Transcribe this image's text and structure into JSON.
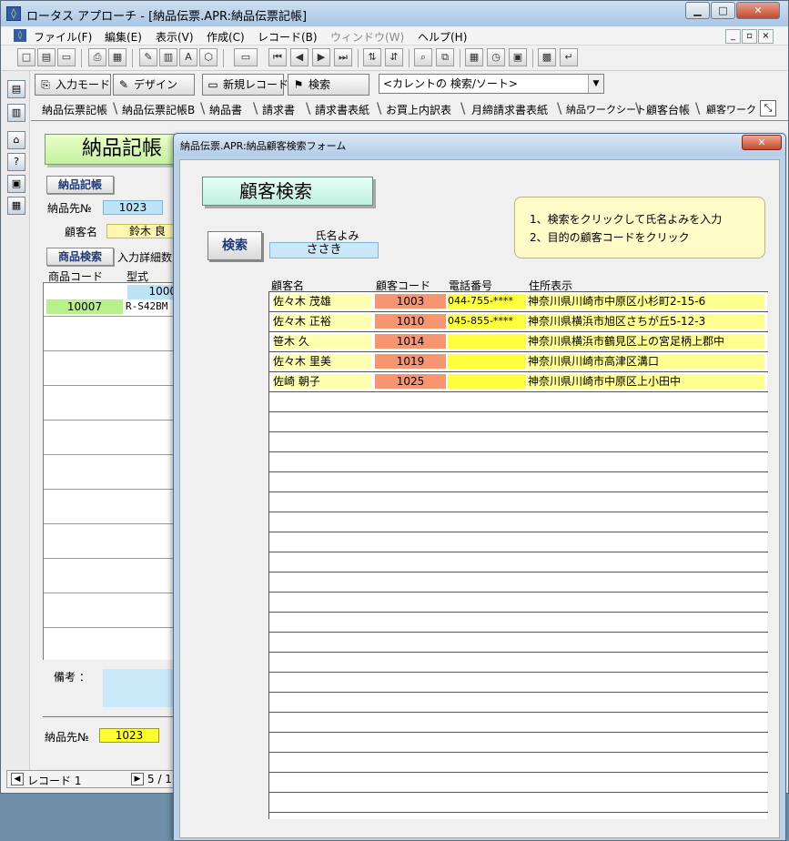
{
  "main_window": {
    "title": "ロータス アプローチ - [納品伝票.APR:納品伝票記帳]",
    "title_icon": "lotus-approach-icon",
    "controls": {
      "minimize": "▁",
      "maximize": "□",
      "close": "✕"
    }
  },
  "menu": {
    "items": [
      "ファイル(F)",
      "編集(E)",
      "表示(V)",
      "作成(C)",
      "レコード(B)",
      "ウィンドウ(W)",
      "ヘルプ(H)"
    ],
    "mdi_controls": [
      "_",
      "▫",
      "×"
    ]
  },
  "toolbar": {
    "icons": [
      "new-file-icon",
      "open-icon",
      "open-folder-icon",
      "print-icon",
      "print-preview-icon",
      "edit-icon",
      "ruler-icon",
      "text-icon",
      "draw-icon",
      "field-icon",
      "first-record-icon",
      "prev-record-icon",
      "next-record-icon",
      "last-record-icon",
      "sort-asc-icon",
      "sort-desc-icon",
      "find-icon",
      "find-all-icon",
      "calendar-icon",
      "timer-icon",
      "clipboard-icon",
      "grid-icon",
      "enter-icon"
    ]
  },
  "left_rail": {
    "icons": [
      "form-icon",
      "report-icon",
      "home-icon",
      "help-icon",
      "server-icon",
      "database-icon"
    ]
  },
  "modebar": {
    "input_mode": "入力モード",
    "design": "デザイン",
    "new_record": "新規レコード",
    "search": "検索",
    "current_search": "<カレントの 検索/ソート>"
  },
  "tabs": [
    "納品伝票記帳",
    "納品伝票記帳B",
    "納品書",
    "請求書",
    "請求書表紙",
    "お買上内訳表",
    "月締請求書表紙",
    "納品ワークシート",
    "顧客台帳",
    "顧客ワークシ"
  ],
  "main_form": {
    "title": "納品記帳",
    "section_delivery": "納品記帳",
    "delivery_no_label": "納品先№",
    "delivery_no_value": "1023",
    "customer_label": "顧客名",
    "customer_value": "鈴木 良",
    "product_search_button": "商品検索",
    "detail_label": "入力詳細数",
    "col_product_code": "商品コード",
    "col_model": "型式",
    "product_rows": [
      {
        "code": "",
        "model": "1000"
      },
      {
        "code": "10007",
        "model": "R-S42BM"
      }
    ],
    "memo_label": "備考 ：",
    "footer_no_label": "納品先№",
    "footer_no_value": "1023"
  },
  "statusbar": {
    "record_label": "レコード 1",
    "page": "5 / 1"
  },
  "popup": {
    "title": "納品伝票.APR:納品顧客検索フォーム",
    "close_label": "✕",
    "heading": "顧客検索",
    "instructions": [
      "1、検索をクリックして氏名よみを入力",
      "2、目的の顧客コードをクリック"
    ],
    "search_button": "検索",
    "kana_label": "氏名よみ",
    "kana_value": "ささき",
    "columns": {
      "name": "顧客名",
      "code": "顧客コード",
      "phone": "電話番号",
      "address": "住所表示"
    },
    "rows": [
      {
        "name": "佐々木 茂雄",
        "code": "1003",
        "phone": "044-755-****",
        "address": "神奈川県川崎市中原区小杉町2-15-6"
      },
      {
        "name": "佐々木 正裕",
        "code": "1010",
        "phone": "045-855-****",
        "address": "神奈川県横浜市旭区さちが丘5-12-3"
      },
      {
        "name": "笹木 久",
        "code": "1014",
        "phone": "",
        "address": "神奈川県横浜市鶴見区上の宮足柄上郡中"
      },
      {
        "name": "佐々木 里美",
        "code": "1019",
        "phone": "",
        "address": "神奈川県川崎市高津区溝口"
      },
      {
        "name": "佐崎 朝子",
        "code": "1025",
        "phone": "",
        "address": "神奈川県川崎市中原区上小田中"
      }
    ]
  }
}
